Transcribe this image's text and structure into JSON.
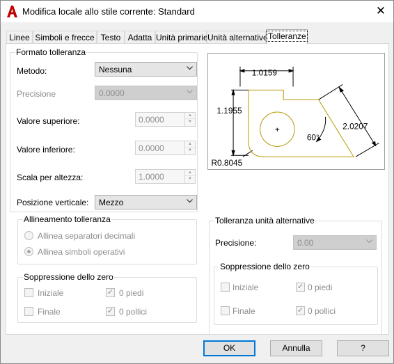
{
  "window": {
    "title": "Modifica locale allo stile corrente: Standard",
    "close_glyph": "✕"
  },
  "tabs": [
    {
      "label": "Linee"
    },
    {
      "label": "Simboli e frecce"
    },
    {
      "label": "Testo"
    },
    {
      "label": "Adatta"
    },
    {
      "label": "Unità primarie"
    },
    {
      "label": "Unità alternative"
    },
    {
      "label": "Tolleranze",
      "active": true
    }
  ],
  "formato": {
    "legend": "Formato tolleranza",
    "metodo_label": "Metodo:",
    "metodo_value": "Nessuna",
    "precisione_label": "Precisione",
    "precisione_value": "0.0000",
    "valore_superiore_label": "Valore superiore:",
    "valore_superiore_value": "0.0000",
    "valore_inferiore_label": "Valore inferiore:",
    "valore_inferiore_value": "0.0000",
    "scala_label": "Scala per altezza:",
    "scala_value": "1.0000",
    "posizione_label": "Posizione verticale:",
    "posizione_value": "Mezzo"
  },
  "allineamento": {
    "legend": "Allineamento tolleranza",
    "option1": "Allinea separatori decimali",
    "option2": "Allinea simboli operativi"
  },
  "soppressione_primary": {
    "legend": "Soppressione dello zero",
    "iniziale": "Iniziale",
    "finale": "Finale",
    "piedi": "0 piedi",
    "pollici": "0 pollici"
  },
  "alt": {
    "legend": "Tolleranza unità alternative",
    "precisione_label": "Precisione:",
    "precisione_value": "0.00"
  },
  "soppressione_alt": {
    "legend": "Soppressione dello zero",
    "iniziale": "Iniziale",
    "finale": "Finale",
    "piedi": "0 piedi",
    "pollici": "0 pollici"
  },
  "preview": {
    "dim_top": "1.0159",
    "dim_left": "1.1955",
    "dim_right": "2.0207",
    "angle": "60°",
    "radius": "R0.8045"
  },
  "buttons": {
    "ok": "OK",
    "annulla": "Annulla",
    "help": "?"
  },
  "colors": {
    "accent": "#0078d7",
    "preview_shape": "#b89800",
    "logo_red": "#c00000"
  }
}
